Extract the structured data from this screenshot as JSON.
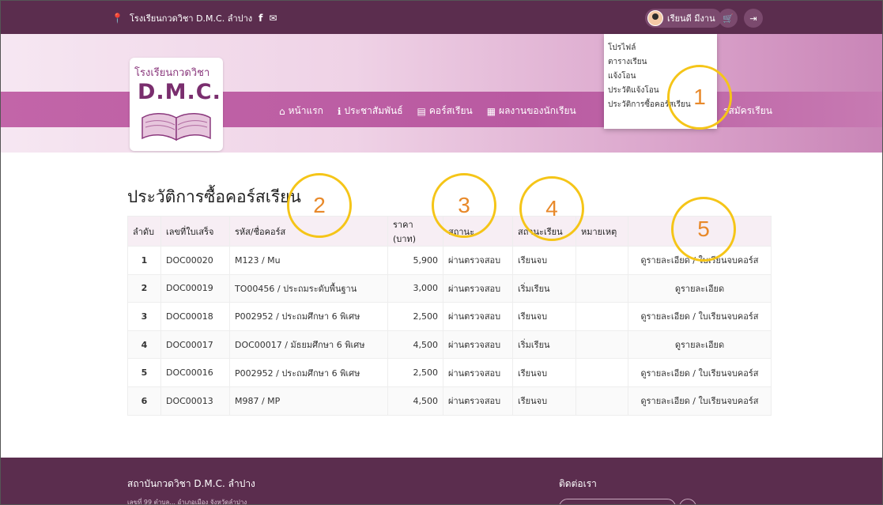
{
  "topbar": {
    "location": "โรงเรียนกวดวิชา D.M.C. ลำปาง",
    "user_name": "เรียนดี มีงาน"
  },
  "logo": {
    "line1": "โรงเรียนกวดวิชา",
    "line2": "D.M.C."
  },
  "nav": {
    "items": [
      {
        "label": "หน้าแรก"
      },
      {
        "label": "ประชาสัมพันธ์"
      },
      {
        "label": "คอร์สเรียน"
      },
      {
        "label": "ผลงานของนักเรียน"
      }
    ],
    "extra": "รสมัครเรียน"
  },
  "dropdown": {
    "items": [
      {
        "label": "โปรไฟล์"
      },
      {
        "label": "ตารางเรียน"
      },
      {
        "label": "แจ้งโอน"
      },
      {
        "label": "ประวัติแจ้งโอน"
      },
      {
        "label": "ประวัติการซื้อคอร์สเรียน"
      }
    ]
  },
  "main": {
    "title": "ประวัติการซื้อคอร์สเรียน",
    "columns": [
      "ลำดับ",
      "เลขที่ใบเสร็จ",
      "รหัส/ชื่อคอร์ส",
      "ราคา (บาท)",
      "สถานะ",
      "สถานะเรียน",
      "หมายเหตุ",
      ""
    ],
    "rows": [
      {
        "no": "1",
        "receipt": "DOC00020",
        "course": "M123 / Mu",
        "price": "5,900",
        "status": "ผ่านตรวจสอบ",
        "study": "เรียนจบ",
        "note": "",
        "action": "ดูรายละเอียด / ใบเรียนจบคอร์ส"
      },
      {
        "no": "2",
        "receipt": "DOC00019",
        "course": "TO00456 / ประถมระดับพื้นฐาน",
        "price": "3,000",
        "status": "ผ่านตรวจสอบ",
        "study": "เริ่มเรียน",
        "note": "",
        "action": "ดูรายละเอียด"
      },
      {
        "no": "3",
        "receipt": "DOC00018",
        "course": "P002952 / ประถมศึกษา 6 พิเศษ",
        "price": "2,500",
        "status": "ผ่านตรวจสอบ",
        "study": "เรียนจบ",
        "note": "",
        "action": "ดูรายละเอียด / ใบเรียนจบคอร์ส"
      },
      {
        "no": "4",
        "receipt": "DOC00017",
        "course": "DOC00017 / มัธยมศึกษา 6 พิเศษ",
        "price": "4,500",
        "status": "ผ่านตรวจสอบ",
        "study": "เริ่มเรียน",
        "note": "",
        "action": "ดูรายละเอียด"
      },
      {
        "no": "5",
        "receipt": "DOC00016",
        "course": "P002952 / ประถมศึกษา 6 พิเศษ",
        "price": "2,500",
        "status": "ผ่านตรวจสอบ",
        "study": "เรียนจบ",
        "note": "",
        "action": "ดูรายละเอียด / ใบเรียนจบคอร์ส"
      },
      {
        "no": "6",
        "receipt": "DOC00013",
        "course": "M987 / MP",
        "price": "4,500",
        "status": "ผ่านตรวจสอบ",
        "study": "เรียนจบ",
        "note": "",
        "action": "ดูรายละเอียด / ใบเรียนจบคอร์ส"
      }
    ]
  },
  "annotations": [
    "1",
    "2",
    "3",
    "4",
    "5"
  ],
  "footer": {
    "title": "สถาบันกวดวิชา D.M.C. ลำปาง",
    "address": "เลขที่ 99 ตำบล... อำเภอเมือง จังหวัดลำปาง",
    "contact_title": "ติดต่อเรา"
  },
  "colors": {
    "topbar": "#5b2d4e",
    "nav": "#c265a8",
    "status_green": "#3a9a2a",
    "annotation": "#f5c518"
  }
}
